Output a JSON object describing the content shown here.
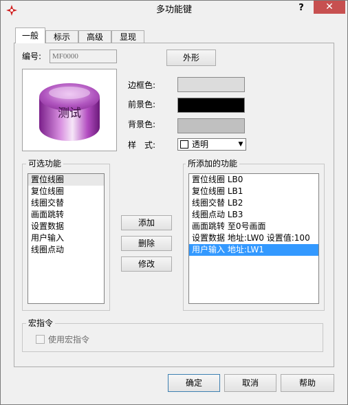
{
  "window": {
    "title": "多功能键",
    "help_label": "?",
    "close_label": "✕"
  },
  "tabs": [
    {
      "label": "一般"
    },
    {
      "label": "标示"
    },
    {
      "label": "高级"
    },
    {
      "label": "显现"
    }
  ],
  "general": {
    "id_label": "编号:",
    "id_value": "MF0000",
    "shape_button": "外形",
    "preview_text": "测试",
    "border_color_label": "边框色:",
    "fg_color_label": "前景色:",
    "bg_color_label": "背景色:",
    "style_label": "样　式:",
    "style_value": "透明",
    "colors": {
      "border": "#dcdcdc",
      "foreground": "#000000",
      "background": "#c0c0c0",
      "preview_purple": "#9b3ea8"
    }
  },
  "available": {
    "title": "可选功能",
    "items": [
      "置位线圈",
      "复位线圈",
      "线圈交替",
      "画面跳转",
      "设置数据",
      "用户输入",
      "线圈点动"
    ]
  },
  "actions": {
    "add": "添加",
    "delete": "删除",
    "modify": "修改"
  },
  "added": {
    "title": "所添加的功能",
    "items": [
      "置位线圈 LB0",
      "复位线圈 LB1",
      "线圈交替 LB2",
      "线圈点动 LB3",
      "画面跳转 至0号画面",
      "设置数据 地址:LW0 设置值:100",
      "用户输入 地址:LW1"
    ]
  },
  "macro": {
    "title": "宏指令",
    "checkbox_label": "使用宏指令"
  },
  "footer": {
    "ok": "确定",
    "cancel": "取消",
    "help": "帮助"
  }
}
